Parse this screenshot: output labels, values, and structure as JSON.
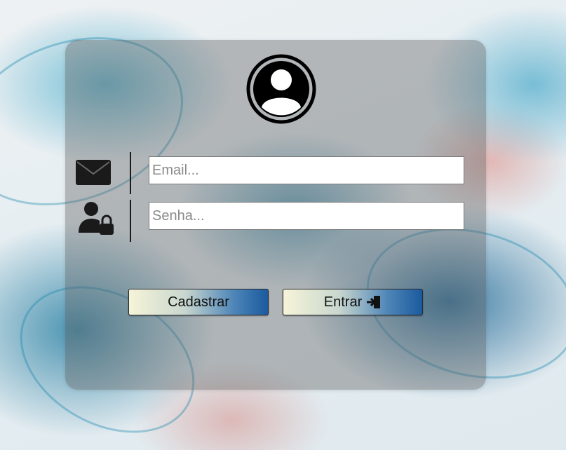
{
  "login": {
    "email_placeholder": "Email...",
    "password_placeholder": "Senha...",
    "register_label": "Cadastrar",
    "enter_label": "Entrar"
  },
  "icons": {
    "avatar": "user-circle-icon",
    "email": "envelope-icon",
    "password": "user-lock-icon",
    "enter": "sign-in-door-icon"
  },
  "colors": {
    "button_gradient_start": "#f6f4d8",
    "button_gradient_end": "#1a5a9e",
    "card_overlay": "rgba(90,90,90,0.38)"
  }
}
